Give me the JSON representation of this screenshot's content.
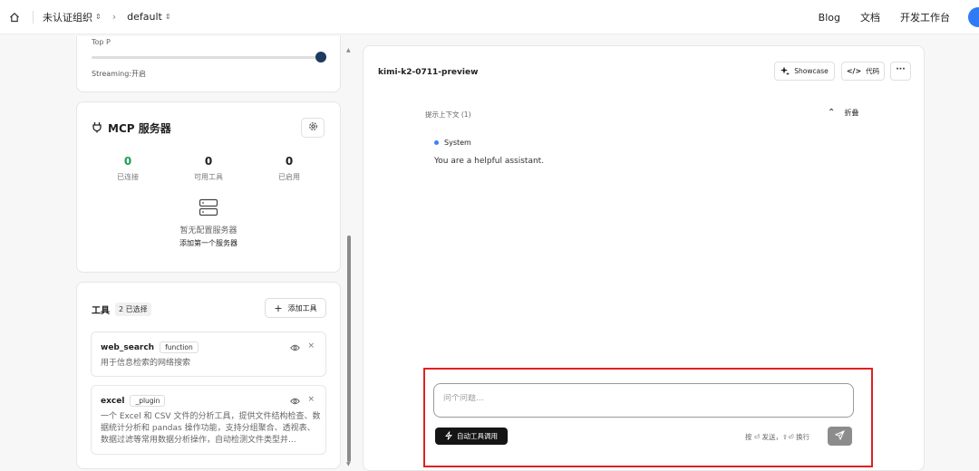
{
  "topbar": {
    "org": "未认证组织",
    "project": "default",
    "links": [
      "Blog",
      "文档",
      "开发工作台"
    ]
  },
  "params": {
    "top_p_label": "Top P",
    "top_p_value": 1.0,
    "streaming": "Streaming:开启"
  },
  "mcp": {
    "title": "MCP 服务器",
    "stats": [
      {
        "value": "0",
        "label": "已连接",
        "color": "#1a9e55"
      },
      {
        "value": "0",
        "label": "可用工具",
        "color": "#222222"
      },
      {
        "value": "0",
        "label": "已启用",
        "color": "#222222"
      }
    ],
    "empty_text": "暂无配置服务器",
    "empty_link": "添加第一个服务器"
  },
  "tools": {
    "title": "工具",
    "selected": "2 已选择",
    "add_label": "添加工具",
    "items": [
      {
        "name": "web_search",
        "tag": "function",
        "desc": "用于信息检索的网络搜索"
      },
      {
        "name": "excel",
        "tag": "_plugin",
        "desc": "一个 Excel 和 CSV 文件的分析工具，提供文件结构检查、数据统计分析和 pandas 操作功能，支持分组聚合、透视表、数据过滤等常用数据分析操作，自动检测文件类型并..."
      }
    ]
  },
  "chat": {
    "model": "kimi-k2-0711-preview",
    "showcase": "Showcase",
    "code": "代码",
    "context_label": "提示上下文 (1)",
    "fold": "折叠",
    "system_label": "System",
    "system_text": "You are a helpful assistant.",
    "input_placeholder": "问个问题...",
    "auto_tool": "自动工具调用",
    "hint": "按 ⏎ 发送，⇧⏎ 换行"
  },
  "colors": {
    "accent_blue": "#2f7bf5",
    "highlight_red": "#e02020",
    "connected_green": "#1a9e55"
  }
}
